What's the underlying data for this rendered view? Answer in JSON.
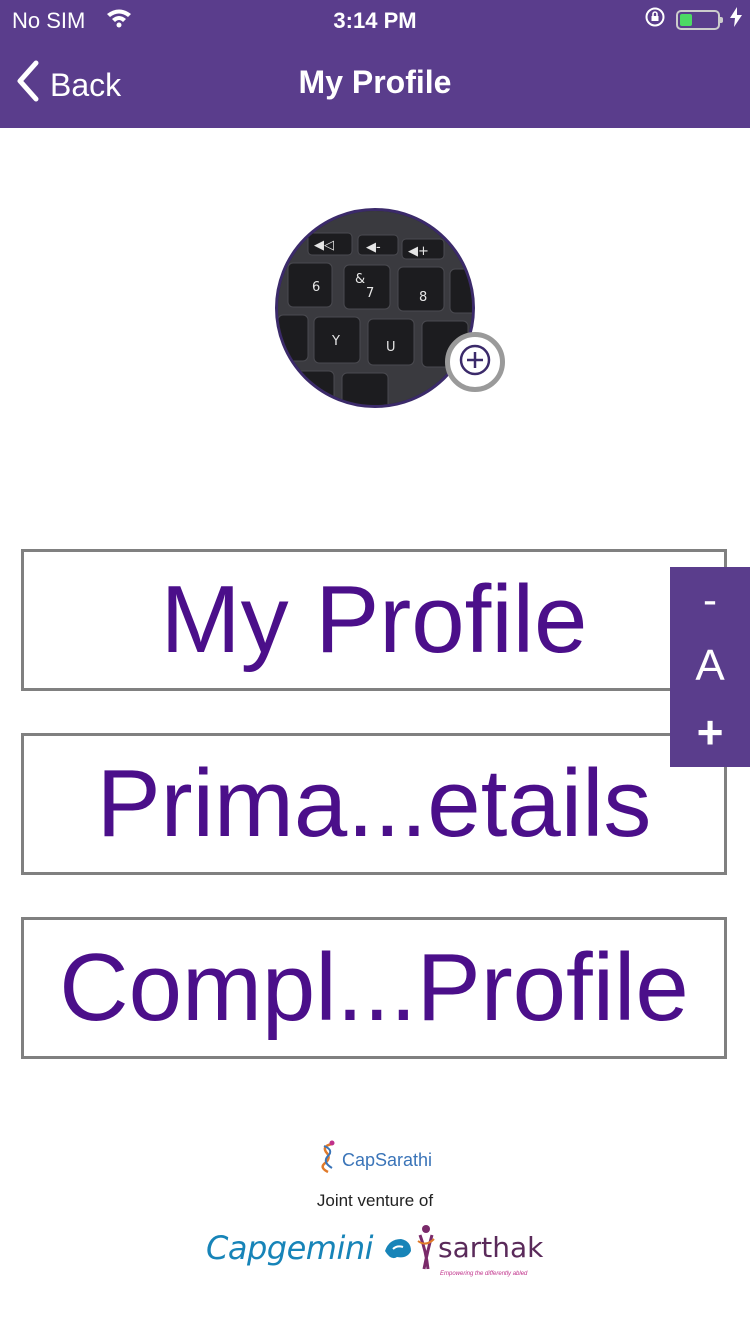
{
  "status_bar": {
    "carrier": "No SIM",
    "time": "3:14 PM"
  },
  "nav": {
    "back_label": "Back",
    "title": "My Profile"
  },
  "avatar": {
    "add_icon": "plus-circle-icon",
    "keycaps": [
      "6",
      "&",
      "7",
      "8",
      "Y",
      "U"
    ]
  },
  "menu": [
    {
      "label": "My Profile"
    },
    {
      "label": "Prima...etails"
    },
    {
      "label": "Compl...Profile"
    }
  ],
  "font_control": {
    "decrease": "-",
    "label": "A",
    "increase": "+"
  },
  "footer": {
    "brand": "CapSarathi",
    "joint_venture": "Joint venture of",
    "partner1": "Capgemini",
    "partner2": "sarthak",
    "partner2_tagline": "Empowering the differently abled"
  },
  "colors": {
    "header_bg": "#5a3d8c",
    "menu_text": "#4b0f8a",
    "menu_border": "#808080"
  }
}
